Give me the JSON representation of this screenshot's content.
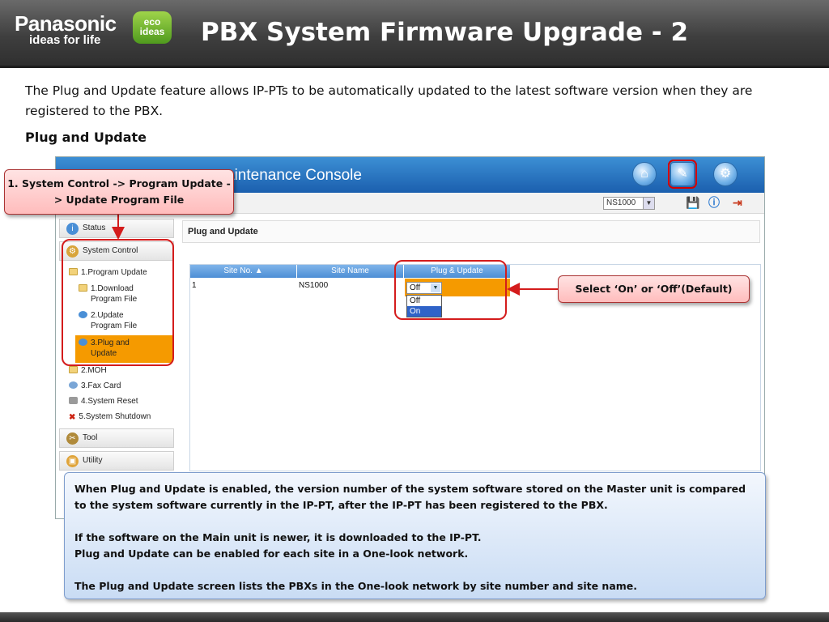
{
  "header": {
    "brand_name": "Panasonic",
    "brand_tagline": "ideas for life",
    "eco_badge_line1": "eco",
    "eco_badge_line2": "ideas",
    "slide_title": "PBX System Firmware Upgrade - 2"
  },
  "intro": "The Plug and Update feature allows IP-PTs to be automatically updated to the latest software version when they are registered to the PBX.",
  "subheading": "Plug and Update",
  "console": {
    "title": "aintenance Console",
    "site_select_value": "NS1000",
    "sidebar": {
      "status": "Status",
      "system_control": "System Control",
      "program_update": "1.Program Update",
      "download_program_file_line1": "1.Download",
      "download_program_file_line2": "Program File",
      "update_program_file_line1": "2.Update",
      "update_program_file_line2": "Program File",
      "plug_and_update_line1": "3.Plug and",
      "plug_and_update_line2": "Update",
      "moh": "2.MOH",
      "fax_card": "3.Fax Card",
      "system_reset": "4.System Reset",
      "system_shutdown": "5.System Shutdown",
      "tool": "Tool",
      "utility": "Utility"
    },
    "page_title": "Plug and Update",
    "table": {
      "headers": [
        "Site No. ▲",
        "Site Name",
        "Plug & Update"
      ],
      "rows": [
        {
          "site_no": "1",
          "site_name": "NS1000",
          "plug_update": "Off"
        }
      ],
      "dropdown_options": [
        "Off",
        "On"
      ]
    }
  },
  "callouts": {
    "step": "1. System Control -> Program Update -> Update Program File",
    "select": "Select ‘On’ or ‘Off’(Default)"
  },
  "note": {
    "p1": "When Plug and Update is enabled, the version number of the system software stored on the Master unit is compared to the system software currently in the IP-PT, after the IP-PT has been registered to the PBX.",
    "p2": "If the software on the Main unit is newer, it is downloaded to the IP-PT.",
    "p3": "Plug and Update can be enabled for each site in a One-look network.",
    "p4": "The Plug and Update screen lists the PBXs in the One-look network by site number and site name."
  },
  "colors": {
    "accent_orange": "#f59a00",
    "callout_red": "#d41c1c",
    "console_blue": "#1b5fae"
  }
}
